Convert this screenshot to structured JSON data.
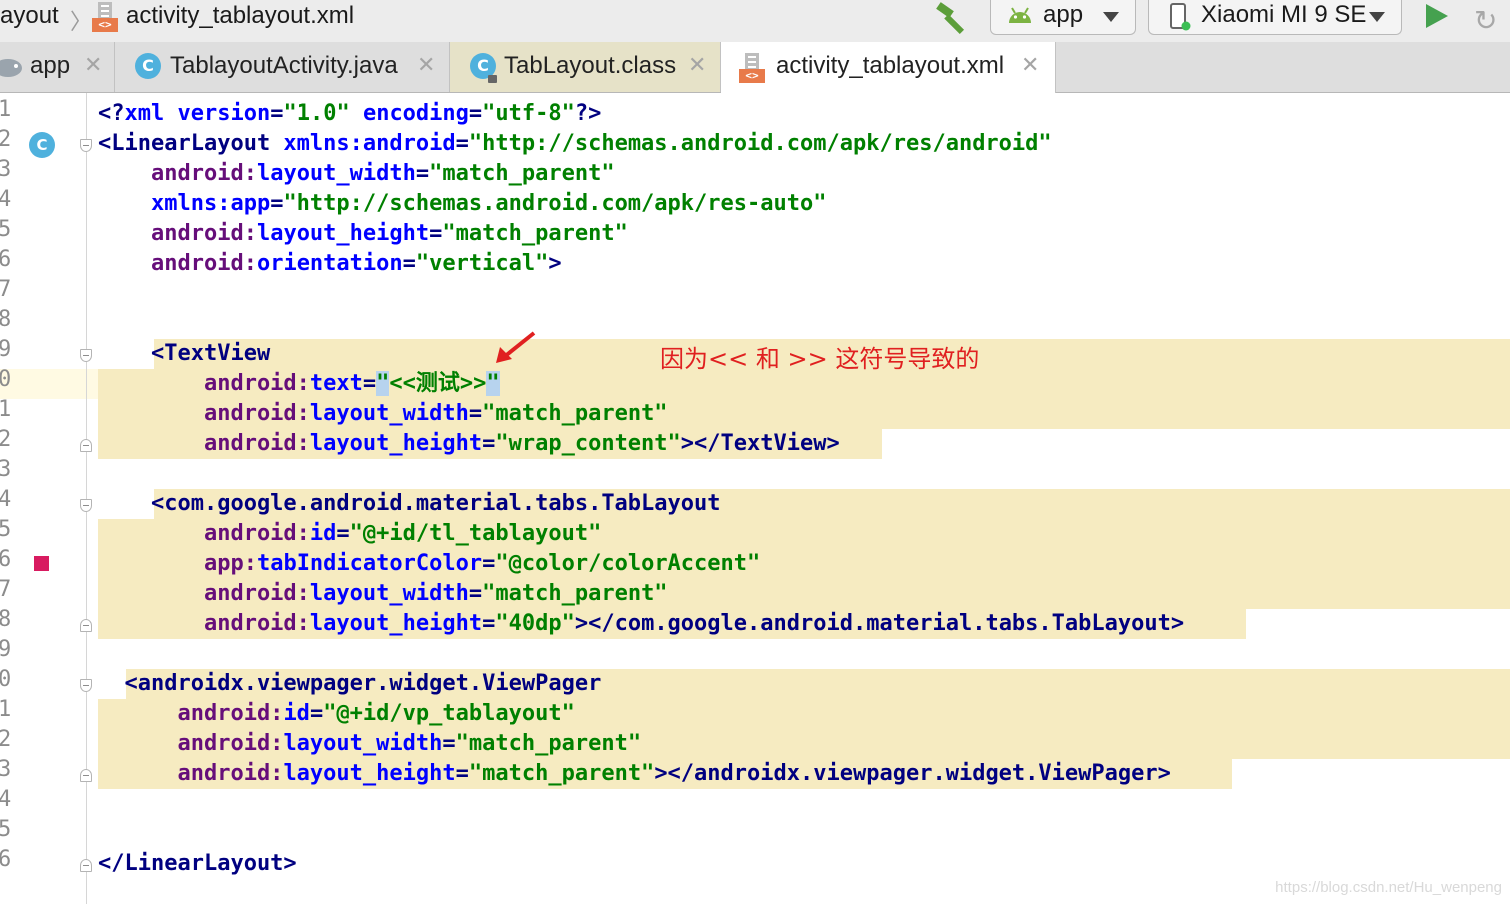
{
  "toolbar": {
    "crumb_prev": "ayout",
    "crumb_file": "activity_tablayout.xml",
    "config_label": "app",
    "device_label": "Xiaomi MI 9 SE"
  },
  "tabs": [
    {
      "label": "app",
      "icon": "android-module-icon"
    },
    {
      "label": "TablayoutActivity.java",
      "icon": "class-icon"
    },
    {
      "label": "TabLayout.class",
      "icon": "class-icon"
    },
    {
      "label": "activity_tablayout.xml",
      "icon": "xml-file-icon",
      "active": true
    }
  ],
  "tab_icon_letter": "C",
  "line_numbers": [
    "1",
    "2",
    "3",
    "4",
    "5",
    "6",
    "7",
    "8",
    "9",
    "0",
    "1",
    "2",
    "3",
    "4",
    "5",
    "6",
    "7",
    "8",
    "9",
    "0",
    "1",
    "2",
    "3",
    "4",
    "5",
    "6"
  ],
  "code": {
    "l1": {
      "p1": "<?",
      "kw": "xml",
      "a1": " version",
      "eq1": "=",
      "s1": "\"1.0\"",
      "a2": " encoding",
      "eq2": "=",
      "s2": "\"utf-8\"",
      "p2": "?>"
    },
    "l2": {
      "tag": "<LinearLayout",
      "ns": " xmlns:android",
      "eq": "=",
      "val": "\"http://schemas.android.com/apk/res/android\""
    },
    "l3": {
      "ns": "    android:",
      "attr": "layout_width",
      "eq": "=",
      "val": "\"match_parent\""
    },
    "l4": {
      "ns": "    xmlns:app",
      "eq": "=",
      "val": "\"http://schemas.android.com/apk/res-auto\""
    },
    "l5": {
      "ns": "    android:",
      "attr": "layout_height",
      "eq": "=",
      "val": "\"match_parent\""
    },
    "l6": {
      "ns": "    android:",
      "attr": "orientation",
      "eq": "=",
      "val": "\"vertical\"",
      "end": ">"
    },
    "l9": {
      "tag": "    <TextView"
    },
    "l10": {
      "ns": "        android:",
      "attr": "text",
      "eq": "=",
      "q1": "\"",
      "val": "<<测试>>",
      "q2": "\""
    },
    "l11": {
      "ns": "        android:",
      "attr": "layout_width",
      "eq": "=",
      "val": "\"match_parent\""
    },
    "l12": {
      "ns": "        android:",
      "attr": "layout_height",
      "eq": "=",
      "val": "\"wrap_content\"",
      "end": "></TextView>"
    },
    "l14": {
      "tag": "    <com.google.android.material.tabs.TabLayout"
    },
    "l15": {
      "ns": "        android:",
      "attr": "id",
      "eq": "=",
      "val": "\"@+id/tl_tablayout\""
    },
    "l16": {
      "ns": "        app:",
      "attr": "tabIndicatorColor",
      "eq": "=",
      "val": "\"@color/colorAccent\""
    },
    "l17": {
      "ns": "        android:",
      "attr": "layout_width",
      "eq": "=",
      "val": "\"match_parent\""
    },
    "l18": {
      "ns": "        android:",
      "attr": "layout_height",
      "eq": "=",
      "val": "\"40dp\"",
      "end": "></com.google.android.material.tabs.TabLayout>"
    },
    "l20": {
      "tag": "  <androidx.viewpager.widget.ViewPager"
    },
    "l21": {
      "ns": "      android:",
      "attr": "id",
      "eq": "=",
      "val": "\"@+id/vp_tablayout\""
    },
    "l22": {
      "ns": "      android:",
      "attr": "layout_width",
      "eq": "=",
      "val": "\"match_parent\""
    },
    "l23": {
      "ns": "      android:",
      "attr": "layout_height",
      "eq": "=",
      "val": "\"match_parent\"",
      "end": "></androidx.viewpager.widget.ViewPager>"
    },
    "l26": {
      "tag": "</LinearLayout>"
    }
  },
  "annotation": "因为<< 和 >> 这符号导致的",
  "watermark": "https://blog.csdn.net/Hu_wenpeng",
  "colors": {
    "tag": "#000080",
    "attr_namespace": "#660e7a",
    "attr_name": "#0000ff",
    "string": "#008000",
    "highlight": "#f6ebc1",
    "annotation": "#e02020",
    "run": "#45a14f"
  }
}
